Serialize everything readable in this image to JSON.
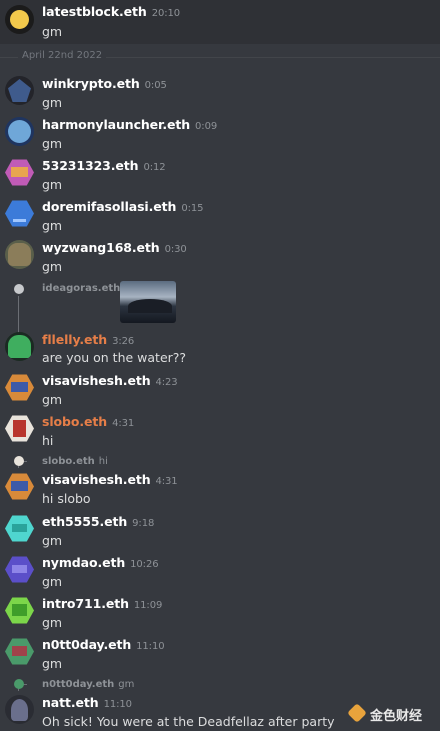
{
  "date_divider": "April 22nd 2022",
  "messages": [
    {
      "user": "latestblock.eth",
      "time": "20:10",
      "text": "gm"
    },
    {
      "user": "winkrypto.eth",
      "time": "0:05",
      "text": "gm"
    },
    {
      "user": "harmonylauncher.eth",
      "time": "0:09",
      "text": "gm"
    },
    {
      "user": "53231323.eth",
      "time": "0:12",
      "text": "gm"
    },
    {
      "user": "doremifasollasi.eth",
      "time": "0:15",
      "text": "gm"
    },
    {
      "user": "wyzwang168.eth",
      "time": "0:30",
      "text": "gm"
    },
    {
      "user": "fllelly.eth",
      "time": "3:26",
      "text": "are you on the water??"
    },
    {
      "user": "visavishesh.eth",
      "time": "4:23",
      "text": "gm"
    },
    {
      "user": "slobo.eth",
      "time": "4:31",
      "text": "hi"
    },
    {
      "user": "visavishesh.eth",
      "time": "4:31",
      "text": "hi slobo"
    },
    {
      "user": "eth5555.eth",
      "time": "9:18",
      "text": "gm"
    },
    {
      "user": "nymdao.eth",
      "time": "10:26",
      "text": "gm"
    },
    {
      "user": "intro711.eth",
      "time": "11:09",
      "text": "gm"
    },
    {
      "user": "n0tt0day.eth",
      "time": "11:10",
      "text": "gm"
    },
    {
      "user": "natt.eth",
      "time": "11:10",
      "text": "Oh sick! You were at the Deadfellaz after party"
    }
  ],
  "replies": [
    {
      "user": "ideagoras.eth",
      "text": ""
    },
    {
      "user": "slobo.eth",
      "text": "hi"
    },
    {
      "user": "n0tt0day.eth",
      "text": "gm"
    }
  ],
  "watermark": "金色财经",
  "colors": {
    "background": "#36393f",
    "username": "#ffffff",
    "username_highlight": "#e67e48",
    "text": "#dcddde",
    "muted": "#8e9297"
  }
}
